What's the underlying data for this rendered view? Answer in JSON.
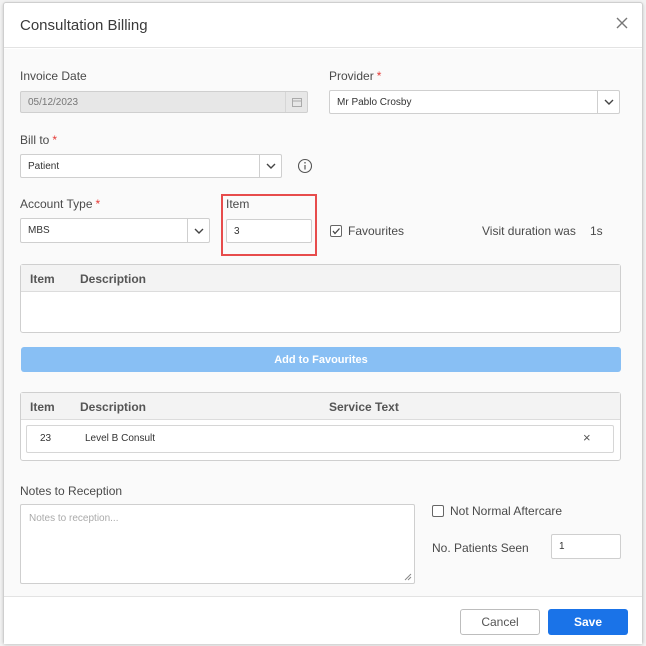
{
  "dialog": {
    "title": "Consultation Billing"
  },
  "form": {
    "invoice_date": {
      "label": "Invoice Date",
      "value": "05/12/2023"
    },
    "provider": {
      "label": "Provider",
      "value": "Mr Pablo Crosby"
    },
    "bill_to": {
      "label": "Bill to",
      "value": "Patient"
    },
    "account_type": {
      "label": "Account Type",
      "value": "MBS"
    },
    "item": {
      "label": "Item",
      "value": "3"
    },
    "favourites_label": "Favourites",
    "visit_duration_label": "Visit duration was",
    "visit_duration_value": "1s"
  },
  "favourites_table": {
    "columns": [
      "Item",
      "Description"
    ]
  },
  "add_favourites_label": "Add to Favourites",
  "items_table": {
    "columns": [
      "Item",
      "Description",
      "Service Text"
    ],
    "rows": [
      {
        "item": "23",
        "description": "Level B Consult",
        "remove": "×"
      }
    ]
  },
  "notes": {
    "label": "Notes to Reception",
    "placeholder": "Notes to reception..."
  },
  "not_normal_aftercare_label": "Not Normal Aftercare",
  "patients_seen": {
    "label": "No. Patients Seen",
    "value": "1"
  },
  "footer": {
    "cancel_label": "Cancel",
    "save_label": "Save"
  },
  "colors": {
    "primary": "#1a73e8",
    "add_button": "#88bff4",
    "required": "#e53935",
    "highlight": "#e74c4c"
  }
}
